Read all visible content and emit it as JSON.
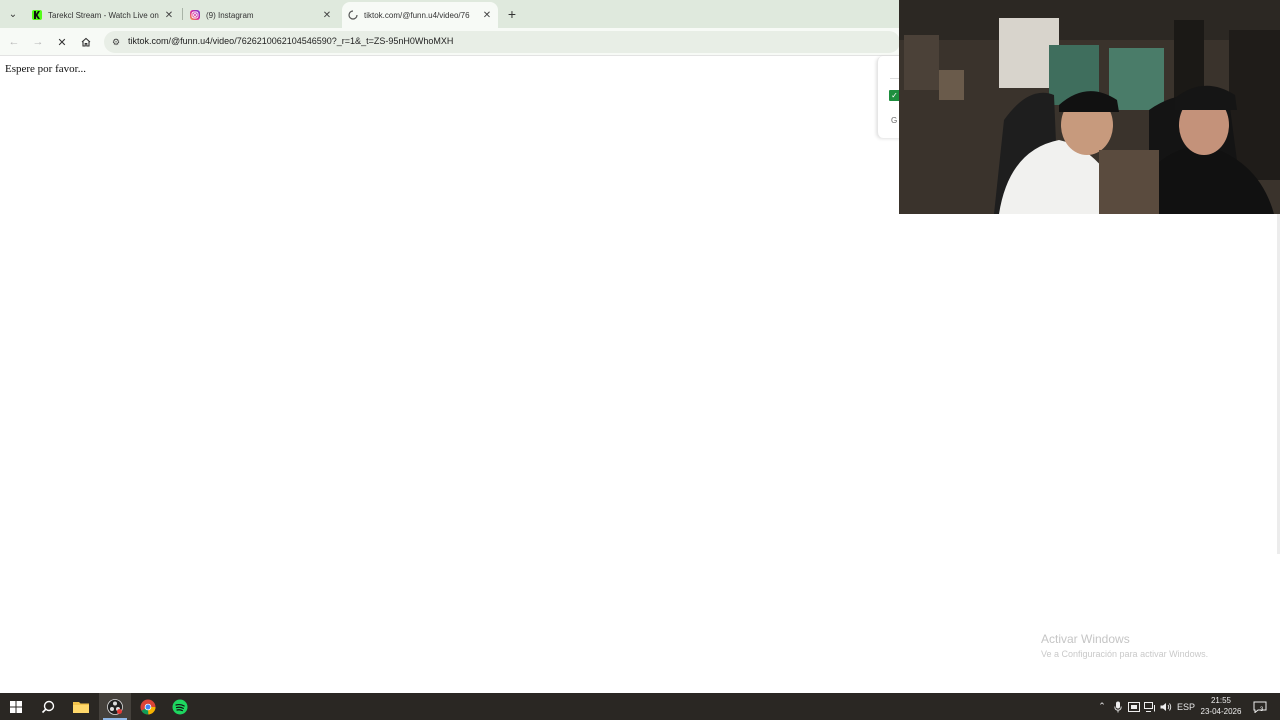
{
  "browser": {
    "tabs": [
      {
        "title": "Tarekcl Stream - Watch Live on",
        "favicon": "kick-icon",
        "favicon_color": "#53fc18"
      },
      {
        "title": "(9) Instagram",
        "favicon": "instagram-icon",
        "favicon_color": "#d6249f"
      },
      {
        "title": "tiktok.com/@funn.u4/video/76",
        "favicon": "loading-spinner-icon",
        "favicon_color": "#555555"
      }
    ],
    "new_tab_label": "+",
    "url": "tiktok.com/@funn.u4/video/7626210062104546590?_r=1&_t=ZS-95nH0WhoMXH"
  },
  "page": {
    "message": "Espere por favor..."
  },
  "side_popup": {
    "letter": "G"
  },
  "watermark": {
    "title": "Activar Windows",
    "subtitle": "Ve a Configuración para activar Windows."
  },
  "taskbar": {
    "apps": [
      "start-icon",
      "search-icon",
      "file-explorer-icon",
      "obs-icon",
      "chrome-icon",
      "spotify-icon"
    ],
    "language": "ESP",
    "time": "21:55",
    "date": "23-04-2026",
    "notification_count": "3"
  }
}
